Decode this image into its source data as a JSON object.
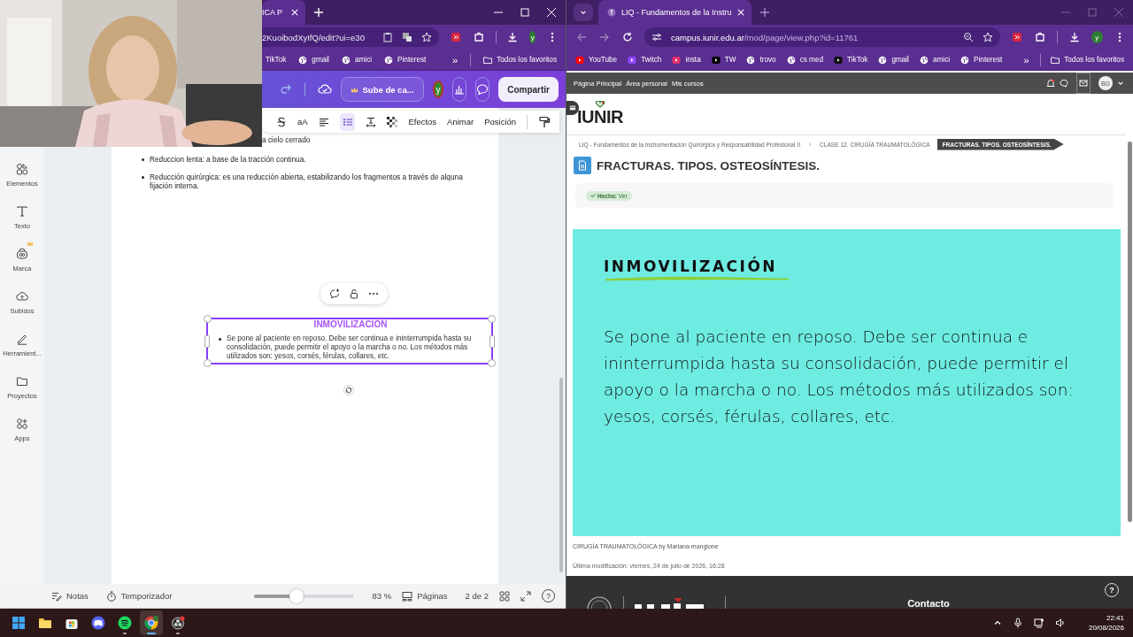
{
  "left_window": {
    "tab": {
      "title": "ICA P"
    },
    "address": "2KuoibodXyIfQ/edit?ui=e30",
    "profile": "y",
    "bookmarks": [
      {
        "label": "TikTok",
        "kind": "logo"
      },
      {
        "label": "gmail",
        "kind": "globe"
      },
      {
        "label": "amici",
        "kind": "globe"
      },
      {
        "label": "Pinterest",
        "kind": "globe"
      }
    ],
    "more_bookmarks": "»",
    "all_bookmarks": "Todos los favoritos",
    "editor_header": {
      "upgrade": "Sube de ca...",
      "avatar": "y",
      "share": "Compartir"
    },
    "format_toolbar": {
      "case_toggle": "aA",
      "bullet_list_selected": true,
      "buttons": [
        "Efectos",
        "Animar",
        "Posición"
      ]
    },
    "sidebar": [
      {
        "label": "Elementos",
        "premium": false
      },
      {
        "label": "Texto",
        "premium": false
      },
      {
        "label": "Marca",
        "premium": true
      },
      {
        "label": "Subidos",
        "premium": false
      },
      {
        "label": "Herramient...",
        "premium": false
      },
      {
        "label": "Proyectos",
        "premium": false
      },
      {
        "label": "Apps",
        "premium": false
      }
    ],
    "document": {
      "cut_line": "a cielo cerrado",
      "bullets": [
        "Reduccion lenta: a base de la tracción continua.",
        "Reducción quirúrgica: es una reducción abierta, estabilizando los fragmentos a través de alquna fijación interna."
      ]
    },
    "selected_box": {
      "heading": "INMOVILIZACIÓN",
      "bullets": [
        "Se pone al paciente en reposo. Debe ser continua e ininterrumpida hasta su consolidación, puede permitir el apoyo o la marcha o no. Los métodos más utilizados son: yesos, corsés, férulas, collares, etc."
      ]
    },
    "bottom_bar": {
      "notes": "Notas",
      "timer": "Temporizador",
      "zoom": {
        "level": 0.5
      },
      "zoom_reading": "83 %",
      "pages": "Páginas",
      "page_count": "2 de 2",
      "help": "?"
    }
  },
  "right_window": {
    "tab": {
      "title": "LIQ - Fundamentos de la Instru"
    },
    "address": {
      "host": "campus.iunir.edu.ar",
      "path": "/mod/page/view.php?id=11761"
    },
    "profile": "y",
    "bookmarks": [
      {
        "label": "YouTube",
        "kind": "logo"
      },
      {
        "label": "Twitch",
        "kind": "logo"
      },
      {
        "label": "insta",
        "kind": "logo"
      },
      {
        "label": "TW",
        "kind": "logo"
      },
      {
        "label": "trovo",
        "kind": "globe"
      },
      {
        "label": "cs med",
        "kind": "globe"
      },
      {
        "label": "TikTok",
        "kind": "logo"
      },
      {
        "label": "gmail",
        "kind": "globe"
      },
      {
        "label": "amici",
        "kind": "globe"
      },
      {
        "label": "Pinterest",
        "kind": "globe"
      }
    ],
    "more_bookmarks": "»",
    "all_bookmarks": "Todos los favoritos",
    "site_nav": {
      "links": [
        "Página Principal",
        "Área personal",
        "Mis cursos"
      ],
      "avatar": "BG"
    },
    "logo": "IUNIR",
    "breadcrumb": [
      {
        "label": "LIQ - Fundamentos de la Instrumentación Quirúrgica y Responsabilidad Profesional II",
        "current": false
      },
      {
        "label": "CLASE 12. CIRUGÍA TRAUMATOLÓGICA",
        "current": false
      },
      {
        "label": "FRACTURAS. TIPOS. OSTEOSÍNTESIS.",
        "current": true
      }
    ],
    "page_title": "FRACTURAS. TIPOS. OSTEOSÍNTESIS.",
    "completion": "**Hecho:** Ver",
    "card": {
      "heading": "INMOVILIZACIÓN",
      "body": "Se pone al paciente en reposo. Debe ser continua e ininterrumpida hasta su consolidación, puede permitir el apoyo o la marcha o no. Los métodos más utilizados son: yesos, corsés, férulas, collares, etc."
    },
    "caption": "CIRUGÍA TRAUMATOLÓGICA by Mariana mangione",
    "modified": "Última modificación: viernes, 24 de julio de 2026, 16:28",
    "footer": {
      "contact": "Contacto",
      "help": "?"
    }
  },
  "taskbar": {
    "apps": [
      {
        "running": false,
        "active": false
      },
      {
        "running": false,
        "active": false
      },
      {
        "running": false,
        "active": false
      },
      {
        "running": false,
        "active": false
      },
      {
        "running": true,
        "active": false
      },
      {
        "running": true,
        "active": true
      },
      {
        "running": true,
        "active": false
      }
    ],
    "time": "22:41",
    "date": "20/08/2026"
  }
}
